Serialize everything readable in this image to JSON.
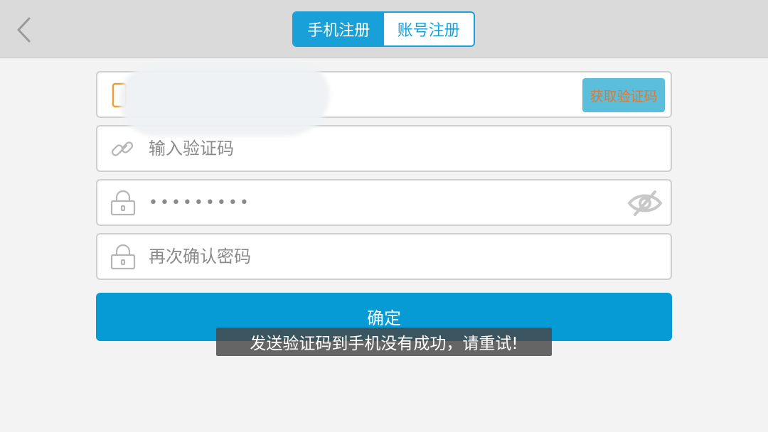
{
  "header": {
    "back_icon": "chevron-left-icon",
    "tabs": [
      {
        "label": "手机注册",
        "active": true
      },
      {
        "label": "账号注册",
        "active": false
      }
    ],
    "accent_color": "#1aa0d8"
  },
  "form": {
    "phone": {
      "icon": "phone-icon",
      "value": "",
      "get_code_label": "获取验证码"
    },
    "code": {
      "icon": "link-icon",
      "placeholder": "输入验证码"
    },
    "password": {
      "icon": "lock-icon",
      "value": "•••••••••",
      "visibility_icon": "eye-off-icon"
    },
    "confirm_password": {
      "icon": "lock-icon",
      "placeholder": "再次确认密码"
    },
    "submit_label": "确定",
    "submit_color": "#069bd4"
  },
  "toast": {
    "message": "发送验证码到手机没有成功，请重试!"
  }
}
